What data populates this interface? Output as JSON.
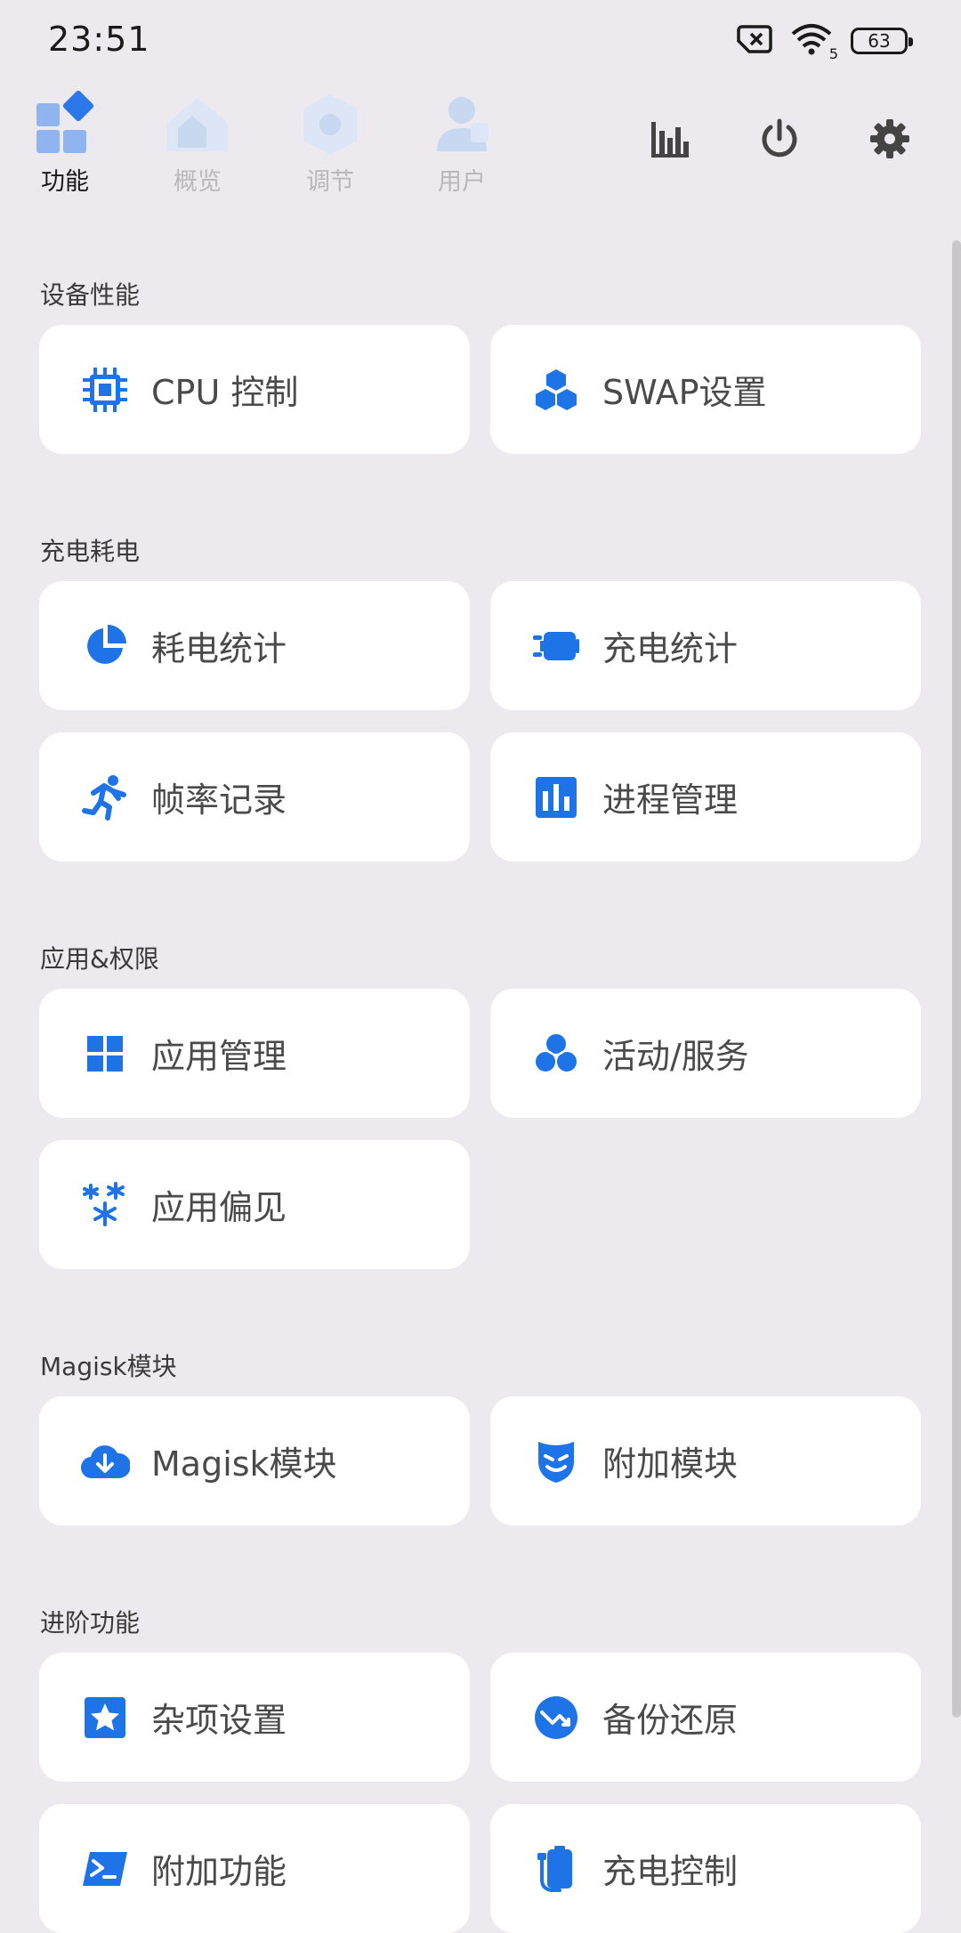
{
  "status_bar": {
    "time": "23:51",
    "battery": "63",
    "icons": [
      "no-sim-icon",
      "wifi-icon"
    ],
    "wifi_badge": "5"
  },
  "top_nav": {
    "tabs": [
      {
        "label": "功能",
        "icon": "features-icon",
        "active": true
      },
      {
        "label": "概览",
        "icon": "overview-icon",
        "active": false
      },
      {
        "label": "调节",
        "icon": "tune-icon",
        "active": false
      },
      {
        "label": "用户",
        "icon": "user-icon",
        "active": false
      }
    ],
    "actions": [
      "bar-chart-icon",
      "power-icon",
      "settings-icon"
    ]
  },
  "sections": [
    {
      "title": "设备性能",
      "items": [
        {
          "label": "CPU 控制",
          "icon": "cpu-icon"
        },
        {
          "label": "SWAP设置",
          "icon": "swap-icon"
        }
      ]
    },
    {
      "title": "充电耗电",
      "items": [
        {
          "label": "耗电统计",
          "icon": "pie-chart-icon"
        },
        {
          "label": "充电统计",
          "icon": "charging-icon"
        },
        {
          "label": "帧率记录",
          "icon": "running-icon"
        },
        {
          "label": "进程管理",
          "icon": "process-icon"
        }
      ]
    },
    {
      "title": "应用&权限",
      "items": [
        {
          "label": "应用管理",
          "icon": "app-grid-icon"
        },
        {
          "label": "活动/服务",
          "icon": "activity-icon"
        },
        {
          "label": "应用偏见",
          "icon": "snowflake-icon"
        }
      ]
    },
    {
      "title": "Magisk模块",
      "items": [
        {
          "label": "Magisk模块",
          "icon": "cloud-download-icon"
        },
        {
          "label": "附加模块",
          "icon": "mask-icon"
        }
      ]
    },
    {
      "title": "进阶功能",
      "items": [
        {
          "label": "杂项设置",
          "icon": "star-icon"
        },
        {
          "label": "备份还原",
          "icon": "backup-icon"
        },
        {
          "label": "附加功能",
          "icon": "terminal-icon"
        },
        {
          "label": "充电控制",
          "icon": "charge-control-icon"
        }
      ]
    }
  ],
  "colors": {
    "accent": "#1e74e6",
    "background": "#eceaee",
    "card": "#ffffff",
    "inactive_tab": "#b8b8bd"
  }
}
